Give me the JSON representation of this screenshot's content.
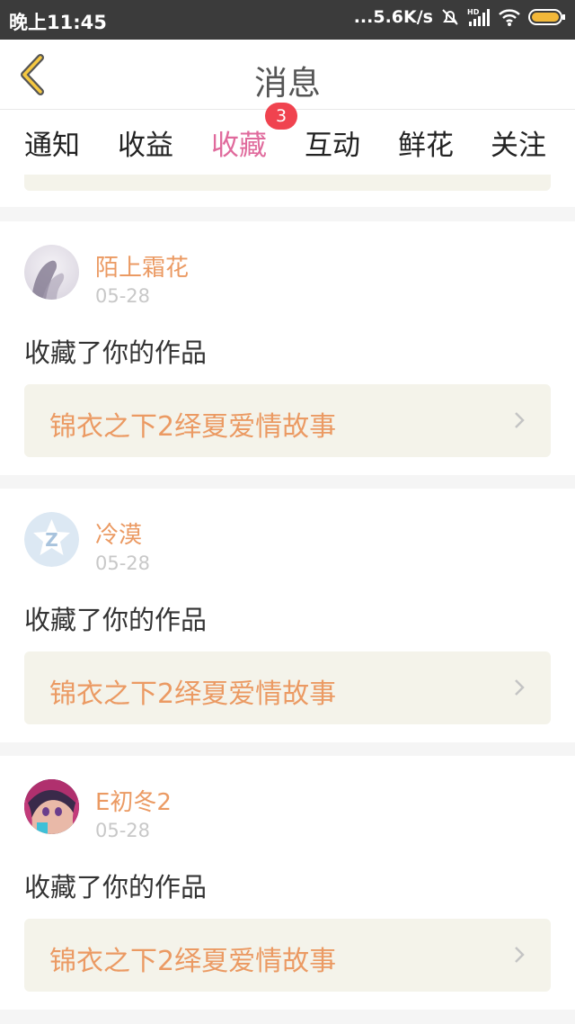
{
  "status_bar": {
    "time": "晚上11:45",
    "network_speed": "...5.6K/s",
    "icons": [
      "alarm-off-icon",
      "hd-signal-icon",
      "wifi-icon",
      "battery-icon"
    ]
  },
  "header": {
    "title": "消息",
    "back_icon": "chevron-left-icon"
  },
  "tabs": [
    {
      "label": "通知",
      "active": false
    },
    {
      "label": "收益",
      "active": false
    },
    {
      "label": "收藏",
      "active": true,
      "badge": "3"
    },
    {
      "label": "互动",
      "active": false
    },
    {
      "label": "鲜花",
      "active": false
    },
    {
      "label": "关注",
      "active": false
    }
  ],
  "notifications": [
    {
      "username": "陌上霜花",
      "date": "05-28",
      "action": "收藏了你的作品",
      "work_title": "锦衣之下2绎夏爱情故事",
      "avatar": "photo-avatar"
    },
    {
      "username": "冷漠",
      "date": "05-28",
      "action": "收藏了你的作品",
      "work_title": "锦衣之下2绎夏爱情故事",
      "avatar": "default-z-avatar"
    },
    {
      "username": "E初冬2",
      "date": "05-28",
      "action": "收藏了你的作品",
      "work_title": "锦衣之下2绎夏爱情故事",
      "avatar": "anime-avatar"
    }
  ],
  "colors": {
    "accent_pink": "#e06a9c",
    "name_orange": "#eb9a63",
    "badge_red": "#f0434f",
    "link_bg": "#f4f3ea"
  }
}
